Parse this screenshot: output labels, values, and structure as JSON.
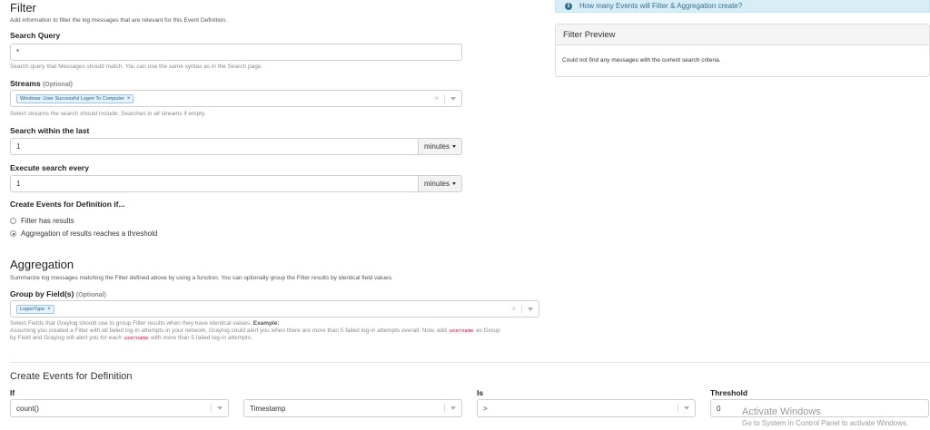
{
  "filter": {
    "title": "Filter",
    "intro": "Add information to filter the log messages that are relevant for this Event Definition.",
    "search_query": {
      "label": "Search Query",
      "value": "*",
      "help": "Search query that Messages should match. You can use the same syntax as in the Search page."
    },
    "streams": {
      "label": "Streams",
      "optional": "(Optional)",
      "chips": [
        "Windows: User Successful Logon To Computer"
      ],
      "help": "Select streams the search should include. Searches in all streams if empty."
    },
    "search_within": {
      "label": "Search within the last",
      "value": "1",
      "unit": "minutes"
    },
    "execute_every": {
      "label": "Execute search every",
      "value": "1",
      "unit": "minutes"
    },
    "create_events": {
      "label": "Create Events for Definition if...",
      "options": [
        {
          "label": "Filter has results",
          "selected": false
        },
        {
          "label": "Aggregation of results reaches a threshold",
          "selected": true
        }
      ]
    }
  },
  "aggregation": {
    "title": "Aggregation",
    "intro": "Summarize log messages matching the Filter defined above by using a function. You can optionally group the Filter results by identical field values.",
    "group_by": {
      "label": "Group by Field(s)",
      "optional": "(Optional)",
      "chips": [
        "LogonType"
      ],
      "help_line1_a": "Select Fields that Graylog should use to group Filter results when they have identical values.",
      "help_line1_b": "Example:",
      "help_line2_a": "Assuming you created a Filter with all failed log-in attempts in your network, Graylog could alert you when there are more than 5 failed log-in attempts overall. Now, add",
      "help_code": "username",
      "help_line2_b": "as Group",
      "help_line3_a": "by Field and Graylog will alert you",
      "help_line3_em": "for each",
      "help_line3_b": "with more than 5 failed log-in attempts."
    }
  },
  "create_events_def": {
    "title": "Create Events for Definition",
    "if_label": "If",
    "if_function": "count()",
    "if_field": "Timestamp",
    "is_label": "Is",
    "is_value": ">",
    "threshold_label": "Threshold",
    "threshold_value": "0"
  },
  "sidebar": {
    "info_text": "How many Events will Filter & Aggregation create?",
    "preview_title": "Filter Preview",
    "preview_body": "Could not find any messages with the current search criteria."
  },
  "watermark": {
    "title": "Activate Windows",
    "subtitle": "Go to System in Control Panel to activate Windows."
  },
  "colors": {
    "info_bg": "#d9edf7",
    "info_text": "#31708f",
    "chip_bg": "#e8f2fb",
    "chip_border": "#9ec5ea"
  }
}
